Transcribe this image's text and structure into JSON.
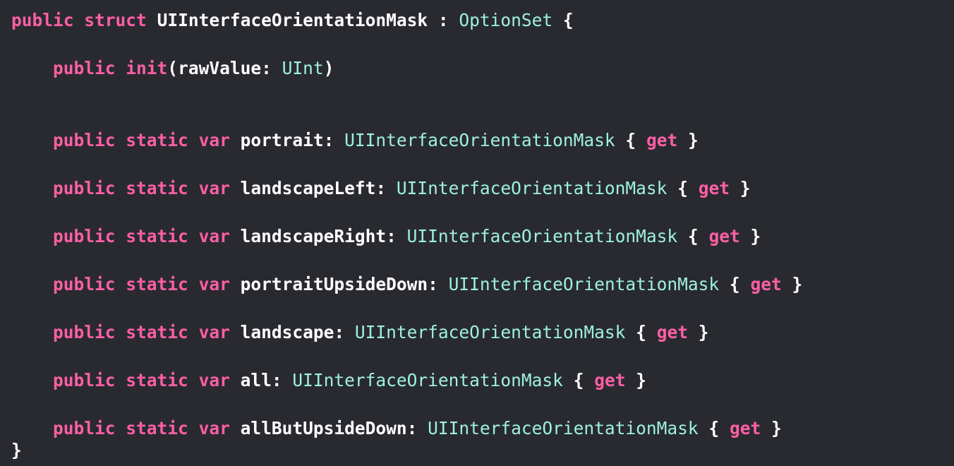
{
  "code": {
    "kw_public": "public",
    "kw_struct": "struct",
    "kw_static": "static",
    "kw_var": "var",
    "kw_init": "init",
    "kw_get": "get",
    "struct_name": "UIInterfaceOrientationMask",
    "protocol": "OptionSet",
    "param": "rawValue:",
    "param_type": "UInt",
    "type": "UIInterfaceOrientationMask",
    "open_brace": "{",
    "close_brace": "}",
    "colon": ":",
    "members": [
      {
        "name": "portrait:"
      },
      {
        "name": "landscapeLeft:"
      },
      {
        "name": "landscapeRight:"
      },
      {
        "name": "portraitUpsideDown:"
      },
      {
        "name": "landscape:"
      },
      {
        "name": "all:"
      },
      {
        "name": "allButUpsideDown:"
      }
    ]
  },
  "colors": {
    "background": "#292a30",
    "keyword": "#fc5fa3",
    "type": "#9ef1dd",
    "plain": "#ffffff"
  }
}
